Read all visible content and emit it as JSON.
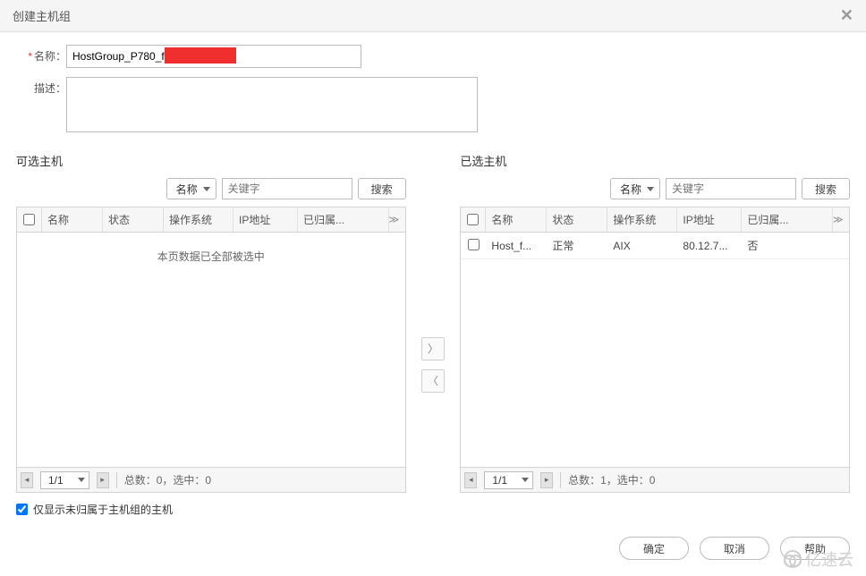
{
  "dialog": {
    "title": "创建主机组"
  },
  "form": {
    "name_label": "名称：",
    "name_value": "HostGroup_P780_f",
    "desc_label": "描述：",
    "desc_value": ""
  },
  "left": {
    "title": "可选主机",
    "search_field": "名称",
    "keyword_placeholder": "关键字",
    "search_btn": "搜索",
    "columns": {
      "name": "名称",
      "status": "状态",
      "os": "操作系统",
      "ip": "IP地址",
      "belonged": "已归属..."
    },
    "empty_msg": "本页数据已全部被选中",
    "page": "1/1",
    "stat": "总数：0，选中：0"
  },
  "right": {
    "title": "已选主机",
    "search_field": "名称",
    "keyword_placeholder": "关键字",
    "search_btn": "搜索",
    "columns": {
      "name": "名称",
      "status": "状态",
      "os": "操作系统",
      "ip": "IP地址",
      "belonged": "已归属..."
    },
    "rows": [
      {
        "name": "Host_f...",
        "status": "正常",
        "os": "AIX",
        "ip": "80.12.7...",
        "belonged": "否"
      }
    ],
    "page": "1/1",
    "stat": "总数：1，选中：0"
  },
  "checkbox_label": "仅显示未归属于主机组的主机",
  "footer": {
    "ok": "确定",
    "cancel": "取消",
    "help": "帮助"
  },
  "watermark": "亿速云"
}
